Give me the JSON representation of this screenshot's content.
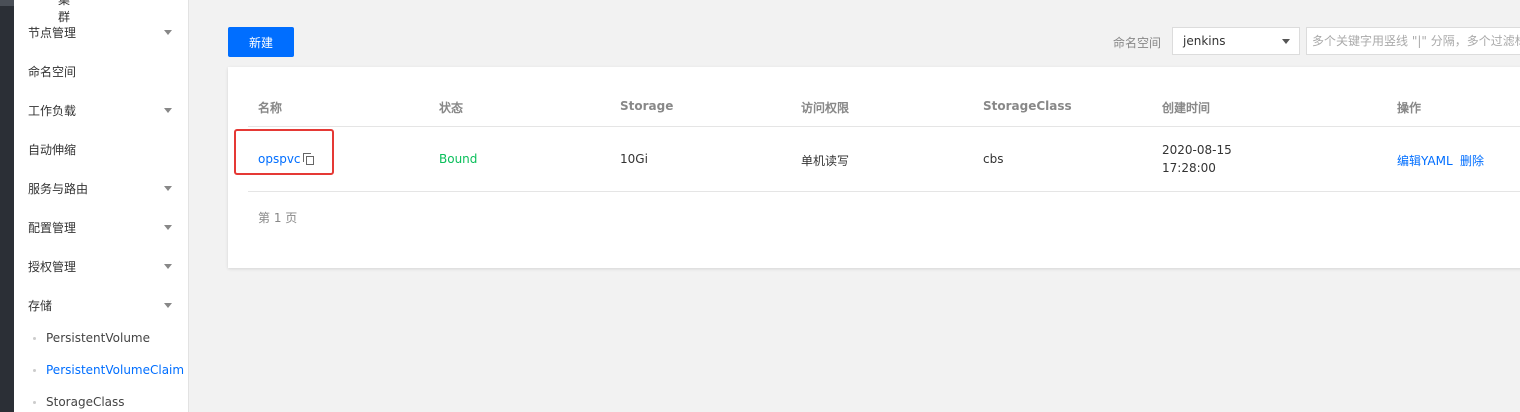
{
  "sidebar": {
    "top_cut_label": "集群",
    "items": [
      {
        "label": "节点管理",
        "has_arrow": true
      },
      {
        "label": "命名空间",
        "has_arrow": false
      },
      {
        "label": "工作负载",
        "has_arrow": true
      },
      {
        "label": "自动伸缩",
        "has_arrow": false
      },
      {
        "label": "服务与路由",
        "has_arrow": true
      },
      {
        "label": "配置管理",
        "has_arrow": true
      },
      {
        "label": "授权管理",
        "has_arrow": true
      },
      {
        "label": "存储",
        "has_arrow": true
      }
    ],
    "sub_items": [
      {
        "label": "PersistentVolume",
        "active": false
      },
      {
        "label": "PersistentVolumeClaim",
        "active": true
      },
      {
        "label": "StorageClass",
        "active": false
      }
    ]
  },
  "toolbar": {
    "new_label": "新建",
    "namespace_label": "命名空间",
    "namespace_value": "jenkins",
    "search_placeholder": "多个关键字用竖线 \"|\" 分隔，多个过滤标"
  },
  "table": {
    "columns": [
      "名称",
      "状态",
      "Storage",
      "访问权限",
      "StorageClass",
      "创建时间",
      "操作"
    ],
    "rows": [
      {
        "name": "opspvc",
        "status": "Bound",
        "storage": "10Gi",
        "access": "单机读写",
        "storage_class": "cbs",
        "created_date": "2020-08-15",
        "created_time": "17:28:00",
        "actions": [
          "编辑YAML",
          "删除"
        ]
      }
    ]
  },
  "pager": {
    "label": "第 1 页"
  },
  "colors": {
    "primary": "#006eff",
    "success": "#0abf5b",
    "highlight": "#e53935"
  }
}
